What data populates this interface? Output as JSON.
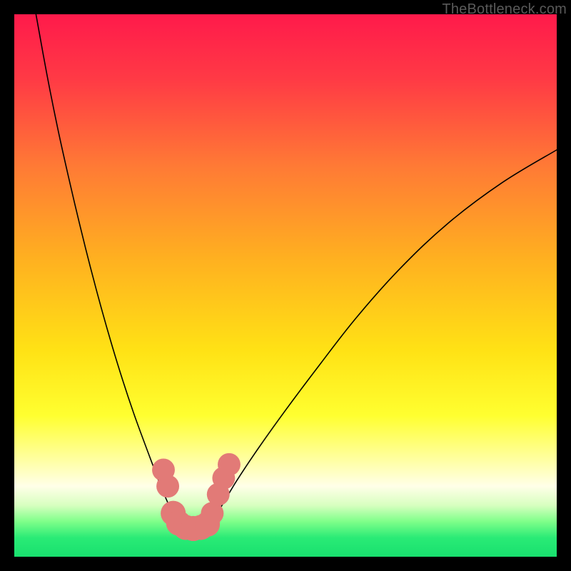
{
  "watermark": "TheBottleneck.com",
  "chart_data": {
    "type": "line",
    "title": "",
    "xlabel": "",
    "ylabel": "",
    "xlim": [
      0,
      100
    ],
    "ylim": [
      0,
      100
    ],
    "background_gradient": {
      "stops": [
        {
          "offset": 0.0,
          "color": "#ff1a4b"
        },
        {
          "offset": 0.12,
          "color": "#ff3a45"
        },
        {
          "offset": 0.28,
          "color": "#ff7a35"
        },
        {
          "offset": 0.45,
          "color": "#ffb020"
        },
        {
          "offset": 0.62,
          "color": "#ffe215"
        },
        {
          "offset": 0.74,
          "color": "#ffff30"
        },
        {
          "offset": 0.82,
          "color": "#ffffa0"
        },
        {
          "offset": 0.87,
          "color": "#ffffe8"
        },
        {
          "offset": 0.905,
          "color": "#d8ffc0"
        },
        {
          "offset": 0.935,
          "color": "#7fff8a"
        },
        {
          "offset": 0.965,
          "color": "#2aeb76"
        },
        {
          "offset": 1.0,
          "color": "#18e06e"
        }
      ]
    },
    "series": [
      {
        "name": "left-branch",
        "x": [
          4,
          6,
          8,
          10,
          12,
          14,
          16,
          18,
          20,
          22,
          24,
          25.5,
          27,
          28.5,
          30
        ],
        "y": [
          100,
          89,
          79,
          70,
          61.5,
          53.5,
          46,
          39,
          32.5,
          26.5,
          21,
          17,
          13,
          9.5,
          6
        ]
      },
      {
        "name": "right-branch",
        "x": [
          36,
          38,
          41,
          45,
          50,
          56,
          63,
          71,
          80,
          90,
          100
        ],
        "y": [
          6,
          9,
          14,
          20,
          27,
          35,
          44,
          53,
          61.5,
          69,
          75
        ]
      },
      {
        "name": "valley-bottom",
        "x": [
          29.5,
          30.5,
          31.5,
          33,
          34.5,
          35.5,
          36.5
        ],
        "y": [
          6.5,
          5.8,
          5.4,
          5.2,
          5.4,
          5.8,
          6.5
        ]
      }
    ],
    "markers": [
      {
        "x": 27.5,
        "y": 16.0,
        "r": 2.0
      },
      {
        "x": 28.3,
        "y": 13.0,
        "r": 2.0
      },
      {
        "x": 29.3,
        "y": 8.0,
        "r": 2.2
      },
      {
        "x": 30.3,
        "y": 6.2,
        "r": 2.2
      },
      {
        "x": 31.6,
        "y": 5.4,
        "r": 2.2
      },
      {
        "x": 33.0,
        "y": 5.2,
        "r": 2.2
      },
      {
        "x": 34.4,
        "y": 5.4,
        "r": 2.2
      },
      {
        "x": 35.6,
        "y": 6.0,
        "r": 2.2
      },
      {
        "x": 36.5,
        "y": 8.0,
        "r": 2.0
      },
      {
        "x": 37.6,
        "y": 11.5,
        "r": 2.0
      },
      {
        "x": 38.6,
        "y": 14.5,
        "r": 2.0
      },
      {
        "x": 39.6,
        "y": 17.0,
        "r": 2.0
      }
    ],
    "marker_color": "#e27a77",
    "curve_color": "#000000",
    "curve_width": 1.6
  }
}
